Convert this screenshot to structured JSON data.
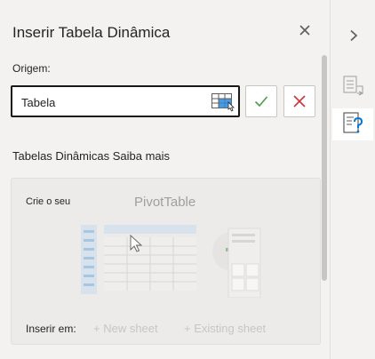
{
  "pane": {
    "title": "Inserir Tabela Dinâmica",
    "origin_label": "Origem:",
    "origin_value": "Tabela",
    "section_heading": "Tabelas Dinâmicas Saiba mais"
  },
  "card": {
    "create_label": "Crie o seu",
    "pivot_label": "PivotTable",
    "insert_label": "Inserir em:",
    "new_sheet": "+ New sheet",
    "existing_sheet": "+ Existing sheet"
  },
  "icons": {
    "close": "close-icon",
    "range_picker": "table-range-picker-icon",
    "confirm": "checkmark-icon",
    "cancel": "x-icon",
    "collapse": "chevron-right-icon",
    "fields": "field-list-icon",
    "help": "help-table-icon"
  },
  "colors": {
    "confirm": "#4a9b4f",
    "cancel": "#d13438",
    "accent": "#0078d4",
    "pane_bg": "#f3f2f1",
    "card_bg": "#ecebea"
  }
}
